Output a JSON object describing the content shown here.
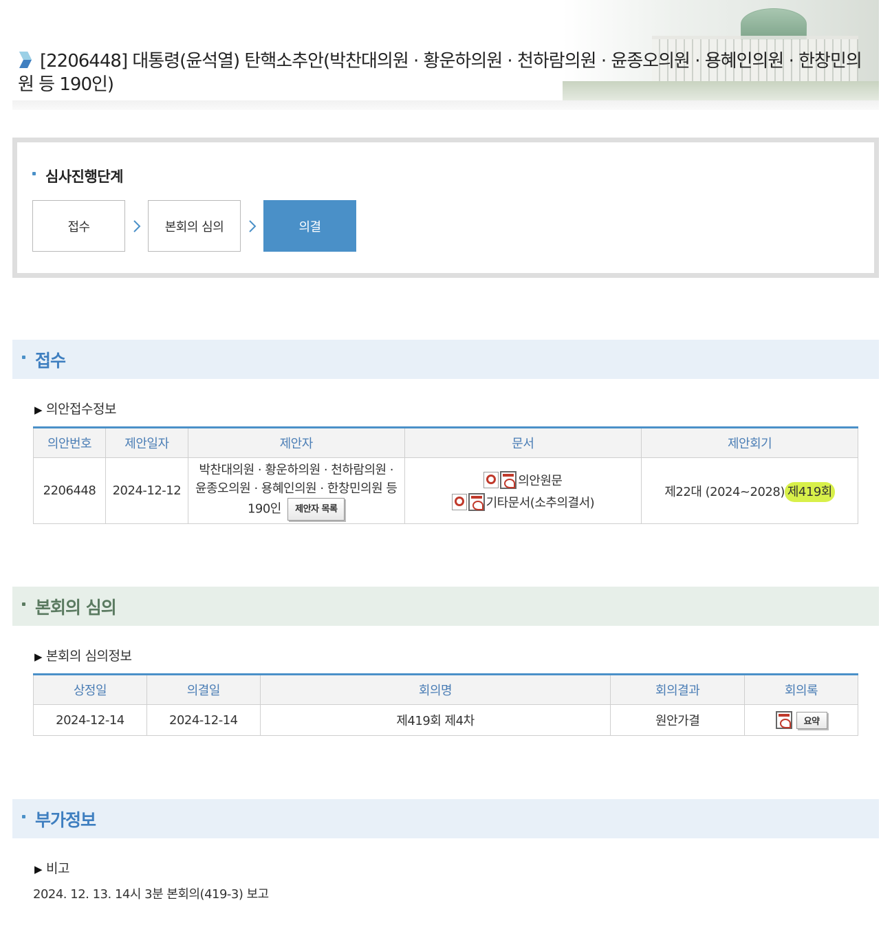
{
  "page": {
    "title": "[2206448] 대통령(윤석열) 탄핵소추안(박찬대의원 · 황운하의원 · 천하람의원 · 윤종오의원 · 용혜인의원 · 한창민의원 등 190인)"
  },
  "progress": {
    "heading": "심사진행단계",
    "steps": [
      "접수",
      "본회의 심의",
      "의결"
    ],
    "active_step": "의결"
  },
  "reception": {
    "section_title": "접수",
    "sub_heading": "의안접수정보",
    "columns": [
      "의안번호",
      "제안일자",
      "제안자",
      "문서",
      "제안회기"
    ],
    "row": {
      "bill_no": "2206448",
      "date": "2024-12-12",
      "proposer": "박찬대의원 · 황운하의원 · 천하람의원 · 윤종오의원 · 용혜인의원 · 한창민의원 등 190인",
      "proposer_button": "제안자 목록",
      "doc1": "의안원문",
      "doc2": "기타문서(소추의결서)",
      "session_prefix": "제22대 (2024~2028)",
      "session_highlight": "제419회"
    }
  },
  "plenary": {
    "section_title": "본회의 심의",
    "sub_heading": "본회의 심의정보",
    "columns": [
      "상정일",
      "의결일",
      "회의명",
      "회의결과",
      "회의록"
    ],
    "row": {
      "introduced": "2024-12-14",
      "decided": "2024-12-14",
      "meeting": "제419회 제4차",
      "result": "원안가결",
      "summary_button": "요약"
    }
  },
  "extra": {
    "section_title": "부가정보",
    "sub_heading": "비고",
    "remark": "2024. 12. 13. 14시 3분 본회의(419-3) 보고"
  },
  "colors": {
    "accent": "#4a90c8",
    "green_section": "#5a7a60",
    "highlight": "#d8f04a"
  }
}
